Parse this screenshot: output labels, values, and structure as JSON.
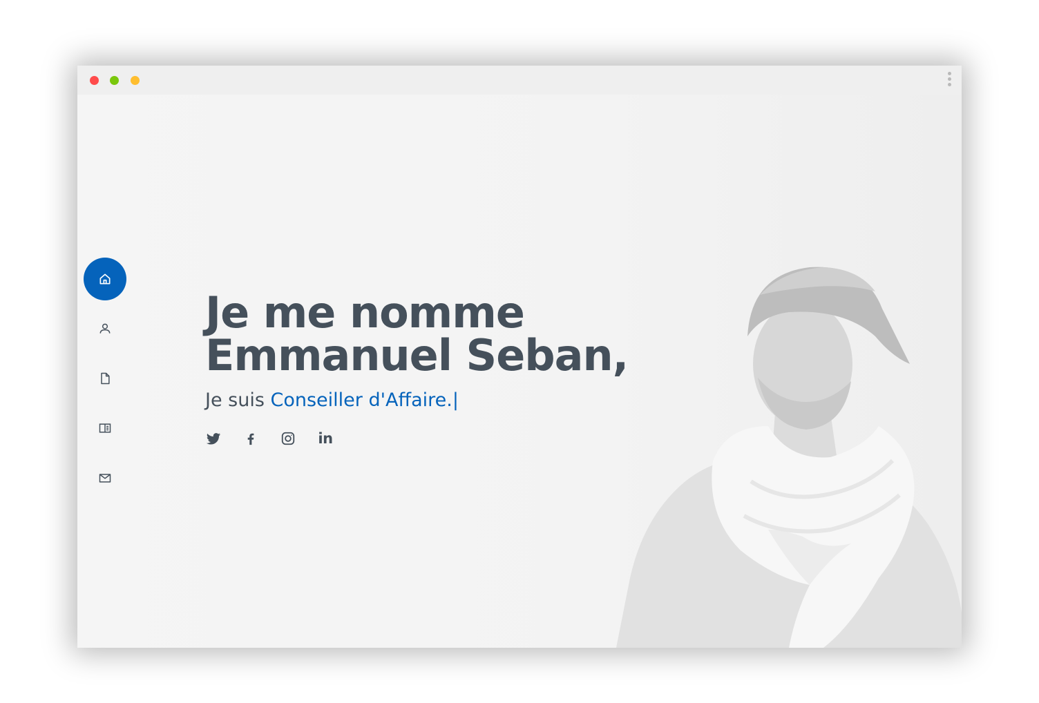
{
  "window": {
    "controls": {
      "close_color": "#ff4b4b",
      "minimize_color": "#7ac70c",
      "maximize_color": "#ffbe2f"
    },
    "menu_icon": "kebab-menu-icon"
  },
  "sidebar": {
    "accent": "#0563bb",
    "items": [
      {
        "icon": "home-icon",
        "active": true
      },
      {
        "icon": "person-icon",
        "active": false
      },
      {
        "icon": "file-icon",
        "active": false
      },
      {
        "icon": "book-half-icon",
        "active": false
      },
      {
        "icon": "envelope-icon",
        "active": false
      }
    ]
  },
  "hero": {
    "title_line1": "Je me nomme",
    "title_line2": "Emmanuel Seban,",
    "subtitle_prefix": "Je suis ",
    "subtitle_typed": "Conseiller d'Affaire.",
    "subtitle_cursor": "|",
    "social": [
      {
        "icon": "twitter-icon"
      },
      {
        "icon": "facebook-icon"
      },
      {
        "icon": "instagram-icon"
      },
      {
        "icon": "linkedin-icon",
        "label": "in"
      }
    ]
  }
}
